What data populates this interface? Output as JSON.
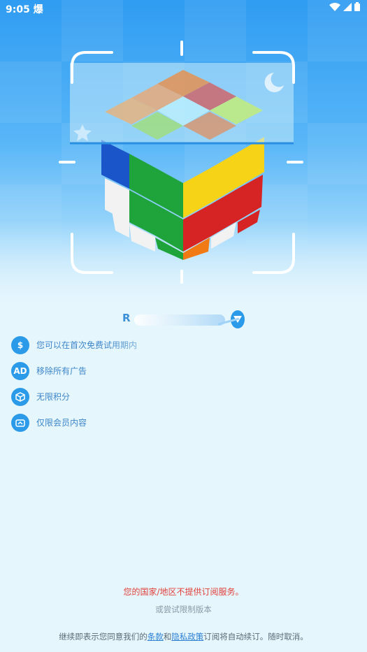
{
  "status_bar": {
    "time": "9:05",
    "app_glyph": "爆",
    "icons": [
      "wifi-icon",
      "signal-icon",
      "battery-icon"
    ]
  },
  "hero": {
    "icons": [
      "rubiks-cube-illustration",
      "moon-icon",
      "star-icon",
      "scan-frame"
    ]
  },
  "banner": {
    "visible_letter": "R"
  },
  "features": [
    {
      "icon": "dollar-icon",
      "icon_text": "$",
      "label": "您可以在首次免费试用期内"
    },
    {
      "icon": "ad-icon",
      "icon_text": "AD",
      "label": "移除所有广告"
    },
    {
      "icon": "cube-points-icon",
      "icon_text": "",
      "label": "无限积分"
    },
    {
      "icon": "crown-icon",
      "icon_text": "",
      "label": "仅限会员内容"
    }
  ],
  "footer": {
    "notice": "您的国家/地区不提供订阅服务。",
    "trial_link": "或尝试限制版本",
    "legal_prefix": "继续即表示您同意我们的",
    "terms": "条款",
    "and": "和",
    "privacy": "隐私政策",
    "legal_suffix": "订阅将自动续订。随时取消。"
  },
  "colors": {
    "primary_blue": "#2b9ae8",
    "notice_red": "#e0403a",
    "background": "#e6f6fd"
  }
}
